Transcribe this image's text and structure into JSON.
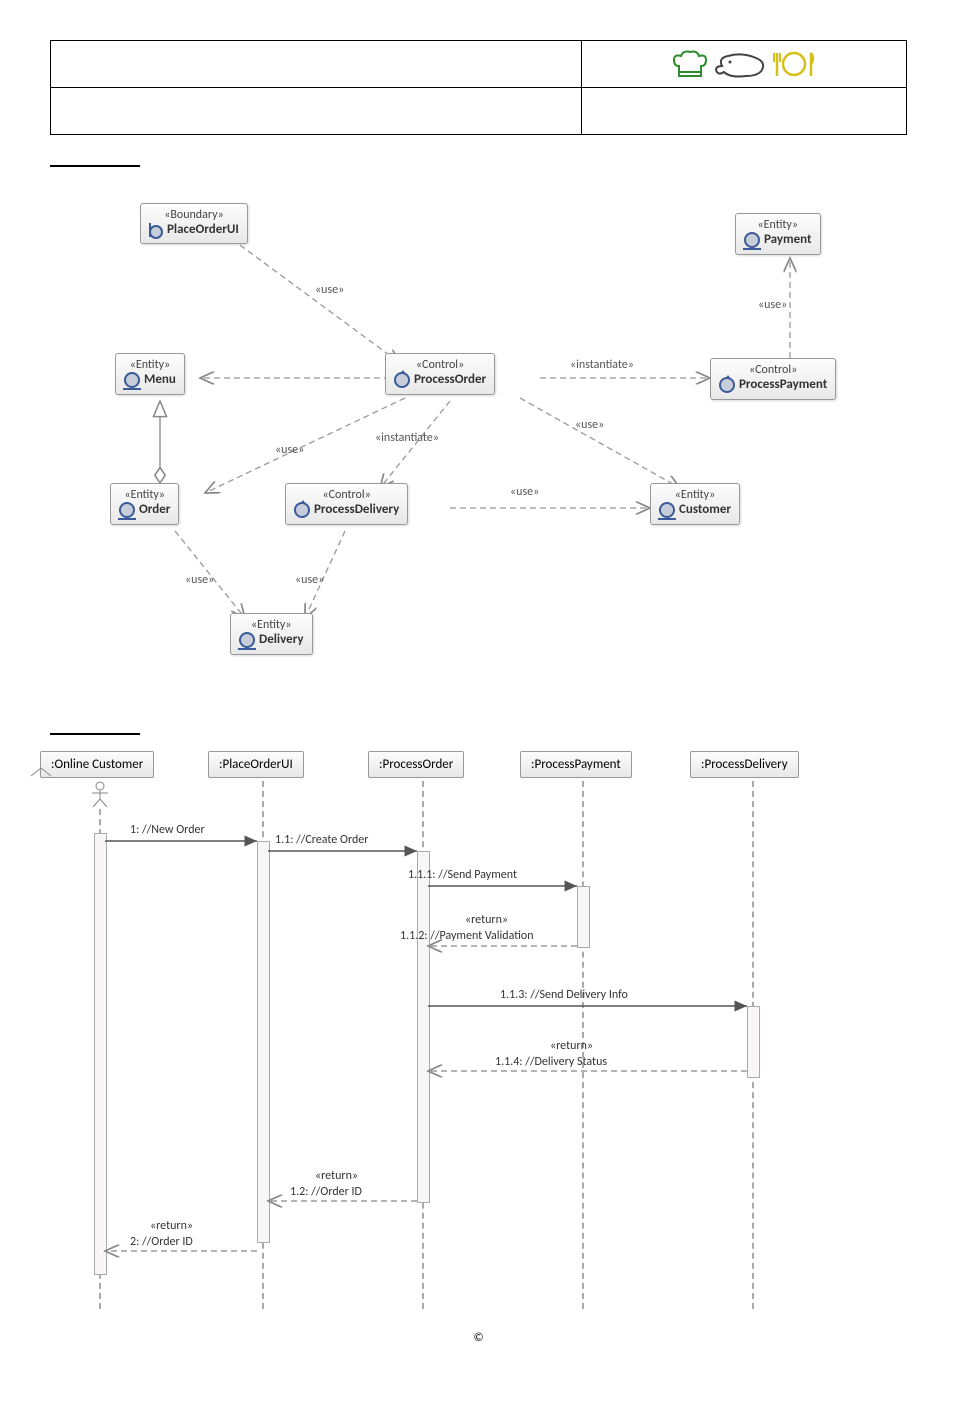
{
  "header": {
    "doc_title": "",
    "doc_right": ""
  },
  "section1_title": "",
  "section2_title": "",
  "uml_class": {
    "boxes": {
      "PlaceOrderUI": {
        "stereo": "«Boundary»",
        "name": "PlaceOrderUI"
      },
      "Menu": {
        "stereo": "«Entity»",
        "name": "Menu"
      },
      "ProcessOrder": {
        "stereo": "«Control»",
        "name": "ProcessOrder"
      },
      "Payment": {
        "stereo": "«Entity»",
        "name": "Payment"
      },
      "ProcessPayment": {
        "stereo": "«Control»",
        "name": "ProcessPayment"
      },
      "Order": {
        "stereo": "«Entity»",
        "name": "Order"
      },
      "ProcessDelivery": {
        "stereo": "«Control»",
        "name": "ProcessDelivery"
      },
      "Customer": {
        "stereo": "«Entity»",
        "name": "Customer"
      },
      "Delivery": {
        "stereo": "«Entity»",
        "name": "Delivery"
      }
    },
    "edges": [
      {
        "from": "PlaceOrderUI",
        "to": "ProcessOrder",
        "label": "«use»"
      },
      {
        "from": "ProcessOrder",
        "to": "ProcessPayment",
        "label": "«instantiate»"
      },
      {
        "from": "ProcessPayment",
        "to": "Payment",
        "label": "«use»"
      },
      {
        "from": "ProcessOrder",
        "to": "Menu",
        "label": ""
      },
      {
        "from": "ProcessOrder",
        "to": "Order",
        "label": "«use»"
      },
      {
        "from": "ProcessOrder",
        "to": "ProcessDelivery",
        "label": "«instantiate»"
      },
      {
        "from": "ProcessOrder",
        "to": "Customer",
        "label": "«use»"
      },
      {
        "from": "ProcessDelivery",
        "to": "Customer",
        "label": "«use»"
      },
      {
        "from": "ProcessDelivery",
        "to": "Delivery",
        "label": "«use»"
      },
      {
        "from": "Order",
        "to": "Delivery",
        "label": "«use»"
      },
      {
        "from": "Order",
        "to": "Menu",
        "label": ""
      }
    ]
  },
  "sequence": {
    "lifelines": [
      ":Online Customer",
      ":PlaceOrderUI",
      ":ProcessOrder",
      ":ProcessPayment",
      ":ProcessDelivery"
    ],
    "messages": [
      {
        "label": "1: //New Order"
      },
      {
        "label": "1.1: //Create Order"
      },
      {
        "label": "1.1.1: //Send Payment"
      },
      {
        "label": "«return»"
      },
      {
        "label": "1.1.2: //Payment Validation"
      },
      {
        "label": "1.1.3: //Send Delivery Info"
      },
      {
        "label": "«return»"
      },
      {
        "label": "1.1.4: //Delivery Status"
      },
      {
        "label": "«return»"
      },
      {
        "label": "1.2: //Order ID"
      },
      {
        "label": "«return»"
      },
      {
        "label": "2: //Order ID"
      }
    ]
  },
  "footer": "©"
}
